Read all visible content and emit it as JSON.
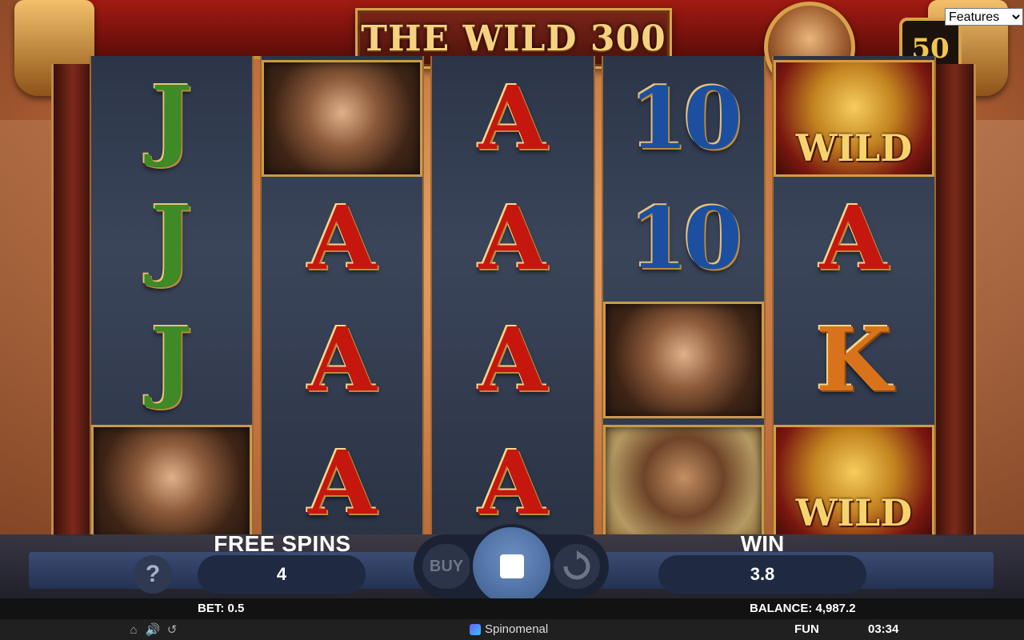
{
  "header": {
    "title": "THE WILD 300",
    "spins_remaining_badge": "50",
    "features_select": {
      "selected": "Features"
    }
  },
  "reels": [
    [
      {
        "type": "letter",
        "value": "J",
        "style": "j"
      },
      {
        "type": "letter",
        "value": "J",
        "style": "j"
      },
      {
        "type": "letter",
        "value": "J",
        "style": "j"
      },
      {
        "type": "portrait",
        "value": "queen"
      }
    ],
    [
      {
        "type": "portrait",
        "value": "queen"
      },
      {
        "type": "letter",
        "value": "A",
        "style": "a"
      },
      {
        "type": "letter",
        "value": "A",
        "style": "a"
      },
      {
        "type": "letter",
        "value": "A",
        "style": "a"
      }
    ],
    [
      {
        "type": "letter",
        "value": "A",
        "style": "a"
      },
      {
        "type": "letter",
        "value": "A",
        "style": "a"
      },
      {
        "type": "letter",
        "value": "A",
        "style": "a"
      },
      {
        "type": "letter",
        "value": "A",
        "style": "a"
      }
    ],
    [
      {
        "type": "letter",
        "value": "10",
        "style": "ten"
      },
      {
        "type": "letter",
        "value": "10",
        "style": "ten"
      },
      {
        "type": "portrait",
        "value": "queen"
      },
      {
        "type": "portrait",
        "value": "king"
      }
    ],
    [
      {
        "type": "wild",
        "value": "WILD"
      },
      {
        "type": "letter",
        "value": "A",
        "style": "a"
      },
      {
        "type": "letter",
        "value": "K",
        "style": "k"
      },
      {
        "type": "wild",
        "value": "WILD"
      }
    ]
  ],
  "controls": {
    "help_label": "?",
    "free_spins_label": "FREE SPINS",
    "free_spins_value": "4",
    "buy_label": "BUY",
    "win_label": "WIN",
    "win_value": "3.8"
  },
  "info": {
    "bet": "BET: 0.5",
    "balance": "BALANCE: 4,987.2"
  },
  "footer": {
    "brand": "Spinomenal",
    "mode": "FUN",
    "clock": "03:34"
  }
}
